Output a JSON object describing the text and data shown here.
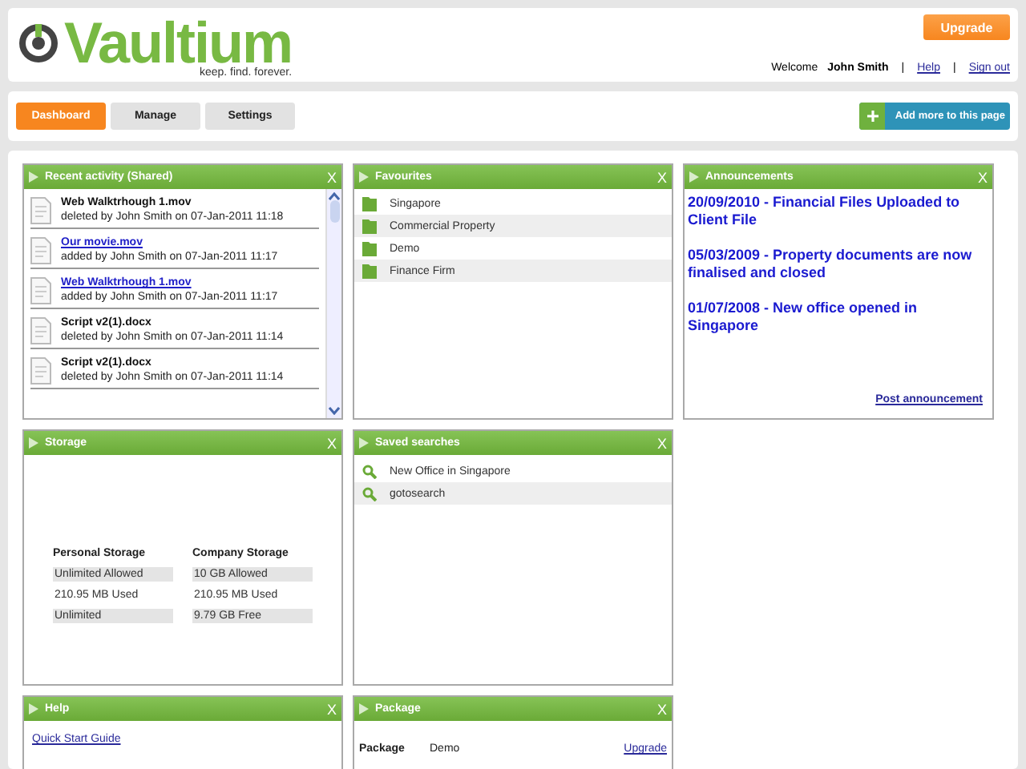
{
  "header": {
    "logo": "Vaultium",
    "tagline": "keep. find. forever.",
    "upgrade_button": "Upgrade",
    "welcome": "Welcome",
    "user": "John Smith",
    "separator": "|",
    "links": [
      "Help",
      "Sign out"
    ]
  },
  "nav": {
    "tabs": [
      {
        "label": "Dashboard",
        "selected": true
      },
      {
        "label": "Manage",
        "selected": false
      },
      {
        "label": "Settings",
        "selected": false
      }
    ],
    "add_button": "Add more to this page"
  },
  "widgets": [
    {
      "kind": "activity",
      "title": "Recent activity (Shared)",
      "close": "X",
      "items": [
        {
          "title": "Web Walktrhough 1.mov",
          "detail": "deleted by John Smith on 07-Jan-2011 11:18",
          "linked": false
        },
        {
          "title": "Our movie.mov",
          "detail": "added by John Smith on 07-Jan-2011 11:17",
          "linked": true
        },
        {
          "title": "Web Walktrhough 1.mov",
          "detail": "added by John Smith on 07-Jan-2011 11:17",
          "linked": true
        },
        {
          "title": "Script v2(1).docx",
          "detail": "deleted by John Smith on 07-Jan-2011 11:14",
          "linked": false
        },
        {
          "title": "Script v2(1).docx",
          "detail": "deleted by John Smith on 07-Jan-2011 11:14",
          "linked": false
        }
      ]
    },
    {
      "kind": "favourites",
      "title": "Favourites",
      "close": "X",
      "items": [
        "Singapore",
        "Commercial Property",
        "Demo",
        "Finance Firm"
      ]
    },
    {
      "kind": "announcements",
      "title": "Announcements",
      "close": "X",
      "items": [
        "20/09/2010 - Financial Files Uploaded to Client File",
        "05/03/2009 - Property documents are now finalised and closed",
        "01/07/2008 - New office opened in Singapore"
      ],
      "link": "Post announcement"
    },
    {
      "kind": "storage",
      "title": "Storage",
      "close": "X",
      "columns": [
        {
          "heading": "Personal Storage",
          "rows": [
            "Unlimited Allowed",
            "210.95 MB Used",
            "Unlimited"
          ]
        },
        {
          "heading": "Company Storage",
          "rows": [
            "10 GB Allowed",
            "210.95 MB Used",
            "9.79 GB Free"
          ]
        }
      ]
    },
    {
      "kind": "saved_searches",
      "title": "Saved searches",
      "close": "X",
      "items": [
        "New Office in Singapore",
        "gotosearch"
      ]
    },
    {
      "kind": "help",
      "title": "Help",
      "close": "X",
      "link": "Quick Start Guide"
    },
    {
      "kind": "package",
      "title": "Package",
      "close": "X",
      "label": "Package",
      "value": "Demo",
      "link": "Upgrade"
    }
  ]
}
